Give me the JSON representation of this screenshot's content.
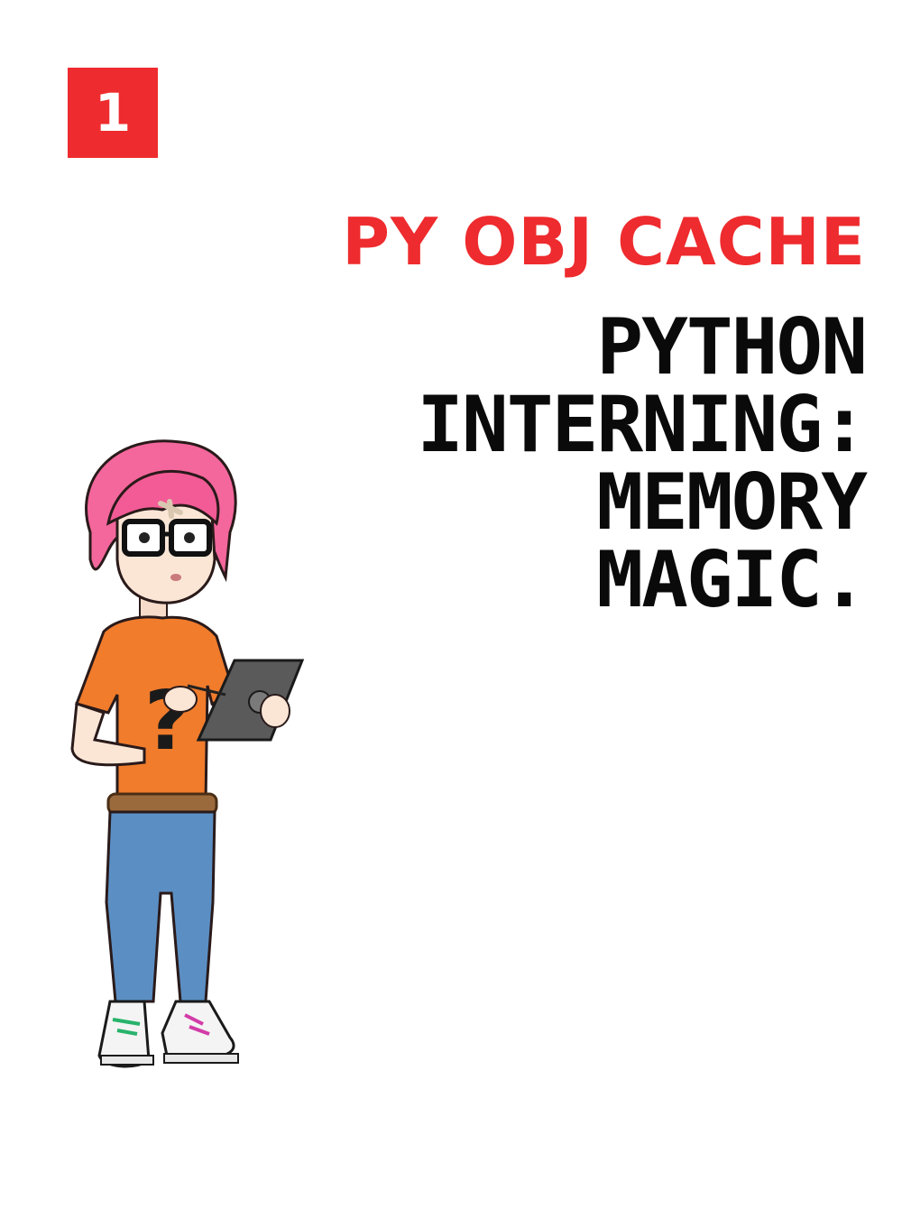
{
  "badge": {
    "number": "1",
    "color": "#ee2b2e"
  },
  "kicker": {
    "text": "PY OBJ CACHE",
    "color": "#ee2b2e"
  },
  "title": {
    "lines": [
      "PYTHON",
      "INTERNING:",
      "MEMORY",
      "MAGIC."
    ]
  },
  "illustration": {
    "icon": "character-with-tablet-illustration",
    "shirt_symbol": "?"
  }
}
